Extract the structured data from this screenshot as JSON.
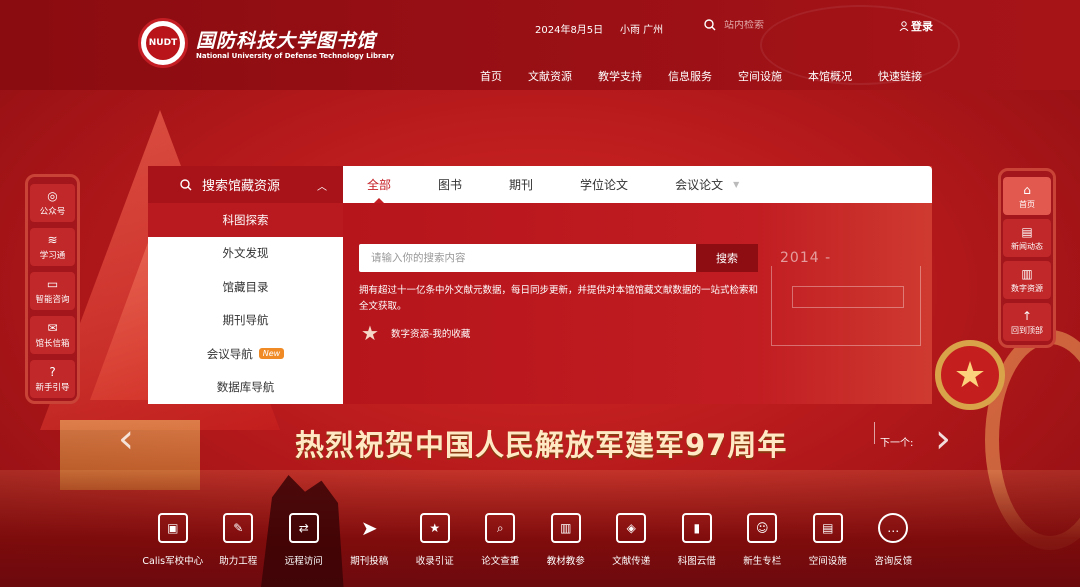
{
  "header": {
    "logo_text": "NUDT",
    "library_name": "国防科技大学图书馆",
    "library_name_en": "National University of Defense Technology Library",
    "date": "2024年8月5日",
    "weather": "小雨  广州",
    "search_placeholder": "站内检索",
    "login_label": "登录",
    "nav": [
      "首页",
      "文献资源",
      "教学支持",
      "信息服务",
      "空间设施",
      "本馆概况",
      "快速链接"
    ]
  },
  "search_panel": {
    "title": "搜索馆藏资源",
    "side_items": [
      {
        "label": "科图探索",
        "active": true
      },
      {
        "label": "外文发现"
      },
      {
        "label": "馆藏目录"
      },
      {
        "label": "期刊导航"
      },
      {
        "label": "会议导航",
        "badge": "New"
      },
      {
        "label": "数据库导航"
      }
    ],
    "tabs": [
      "全部",
      "图书",
      "期刊",
      "学位论文",
      "会议论文"
    ],
    "input_placeholder": "请输入你的搜索内容",
    "search_button": "搜索",
    "description": "拥有超过十一亿条中外文献元数据，每日同步更新，并提供对本馆馆藏文献数据的一站式检索和全文获取。",
    "favorites_label": "数字资源-我的收藏",
    "year_text": "2014 -"
  },
  "banner": {
    "slogan": "热烈祝贺中国人民解放军建军97周年",
    "next_label": "下一个:"
  },
  "left_bar": [
    {
      "label": "公众号",
      "icon": "wechat-icon"
    },
    {
      "label": "学习通",
      "icon": "study-icon"
    },
    {
      "label": "智能咨询",
      "icon": "chat-icon"
    },
    {
      "label": "馆长信箱",
      "icon": "mail-icon"
    },
    {
      "label": "新手引导",
      "icon": "help-icon"
    }
  ],
  "right_bar": [
    {
      "label": "首页",
      "icon": "home-icon",
      "active": true
    },
    {
      "label": "新闻动态",
      "icon": "news-icon"
    },
    {
      "label": "数字资源",
      "icon": "chart-icon"
    },
    {
      "label": "回到顶部",
      "icon": "arrow-up-icon"
    }
  ],
  "quick_links": [
    {
      "label": "Calis军校中心",
      "icon": "calis-icon"
    },
    {
      "label": "助力工程",
      "icon": "support-icon"
    },
    {
      "label": "远程访问",
      "icon": "remote-icon"
    },
    {
      "label": "期刊投稿",
      "icon": "send-icon"
    },
    {
      "label": "收录引证",
      "icon": "citation-icon"
    },
    {
      "label": "论文查重",
      "icon": "check-icon"
    },
    {
      "label": "教材教参",
      "icon": "books-icon"
    },
    {
      "label": "文献传递",
      "icon": "delivery-icon"
    },
    {
      "label": "科图云借",
      "icon": "cloud-icon"
    },
    {
      "label": "新生专栏",
      "icon": "student-icon"
    },
    {
      "label": "空间设施",
      "icon": "space-icon"
    },
    {
      "label": "咨询反馈",
      "icon": "feedback-icon"
    }
  ]
}
